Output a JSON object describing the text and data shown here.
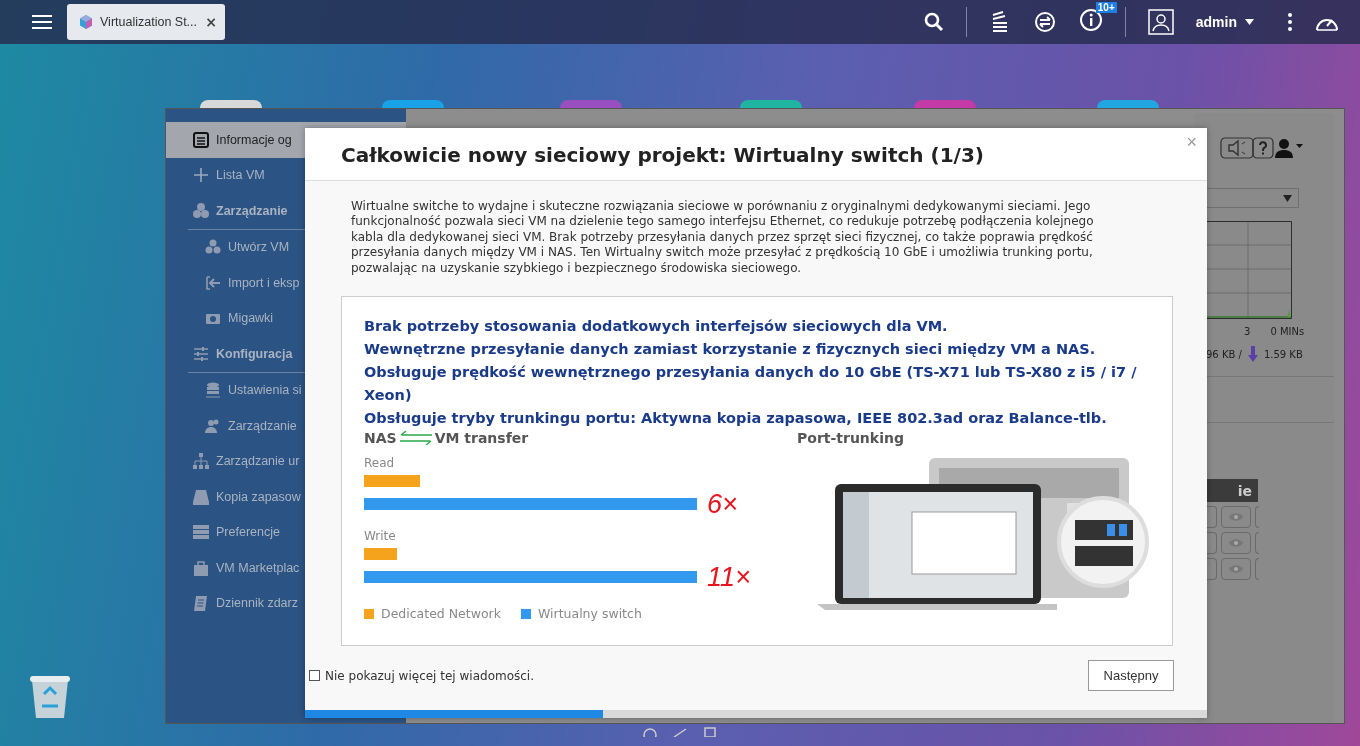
{
  "topbar": {
    "tab": {
      "title": "Virtualization St...",
      "close": "×"
    },
    "notification_badge": "10+",
    "user": "admin"
  },
  "app": {
    "sidebar": {
      "items": [
        {
          "label": "Informacje og",
          "kind": "item",
          "selected": true
        },
        {
          "label": "Lista VM",
          "kind": "item",
          "selected": false
        },
        {
          "label": "Zarządzanie",
          "kind": "group",
          "selected": false,
          "children": [
            {
              "label": "Utwórz VM",
              "selected": false
            },
            {
              "label": "Import i eksp",
              "selected": false
            },
            {
              "label": "Migawki",
              "selected": false
            }
          ]
        },
        {
          "label": "Konfiguracja",
          "kind": "group",
          "selected": false,
          "children": [
            {
              "label": "Ustawienia si",
              "selected": false
            },
            {
              "label": "Zarządzanie",
              "selected": false
            }
          ]
        },
        {
          "label": "Zarządzanie ur",
          "kind": "item",
          "selected": false
        },
        {
          "label": "Kopia zapasow",
          "kind": "item",
          "selected": false
        },
        {
          "label": "Preferencje",
          "kind": "item",
          "selected": false
        },
        {
          "label": "VM Marketplac",
          "kind": "item",
          "selected": false
        },
        {
          "label": "Dziennik zdarz",
          "kind": "item",
          "selected": false
        }
      ]
    },
    "panel": {
      "graph_axis": [
        "3",
        "0 MINs"
      ],
      "upload": "96 KB /",
      "download": "1.59 KB",
      "table_header": "ie"
    }
  },
  "dialog": {
    "title": "Całkowicie nowy sieciowy projekt: Wirtualny switch (1/3)",
    "close": "×",
    "description": "Wirtualne switche to wydajne i skuteczne rozwiązania sieciowe w porównaniu z oryginalnymi dedykowanymi sieciami. Jego funkcjonalność pozwala sieci VM na dzielenie tego samego interfejsu Ethernet, co redukuje potrzebę podłączenia kolejnego kabla dla dedykowanej sieci VM. Brak potrzeby przesyłania danych przez sprzęt sieci fizycznej, co także poprawia prędkość przesyłania danych między VM i NAS. Ten Wirtualny switch może przesyłać z prędkością 10 GbE i umożliwia trunking portu, pozwalając na uzyskanie szybkiego i bezpiecznego środowiska sieciowego.",
    "features": [
      "Brak potrzeby stosowania dodatkowych interfejsów sieciowych dla VM.",
      "Wewnętrzne przesyłanie danych zamiast korzystanie z fizycznych sieci między VM a NAS.",
      "Obsługuje prędkość wewnętrznego przesyłania danych do 10 GbE (TS-X71 lub TS-X80 z i5 / i7 / Xeon)",
      "Obsługuje tryby trunkingu portu: Aktywna kopia zapasowa, IEEE 802.3ad oraz Balance-tlb."
    ],
    "transfer": {
      "title_left": "NAS",
      "title_right": "VM transfer",
      "groups": [
        {
          "label": "Read",
          "multiplier": "6×"
        },
        {
          "label": "Write",
          "multiplier": "11×"
        }
      ],
      "legend": [
        {
          "label": "Dedicated Network",
          "color": "#f5a31c"
        },
        {
          "label": "Wirtualny switch",
          "color": "#3399ee"
        }
      ]
    },
    "port_trunking": {
      "title": "Port-trunking"
    },
    "dont_show_again": {
      "label": "Nie pokazuj więcej tej wiadomości.",
      "checked": false
    },
    "next_button": "Następny",
    "progress": {
      "level": 0.33
    }
  }
}
